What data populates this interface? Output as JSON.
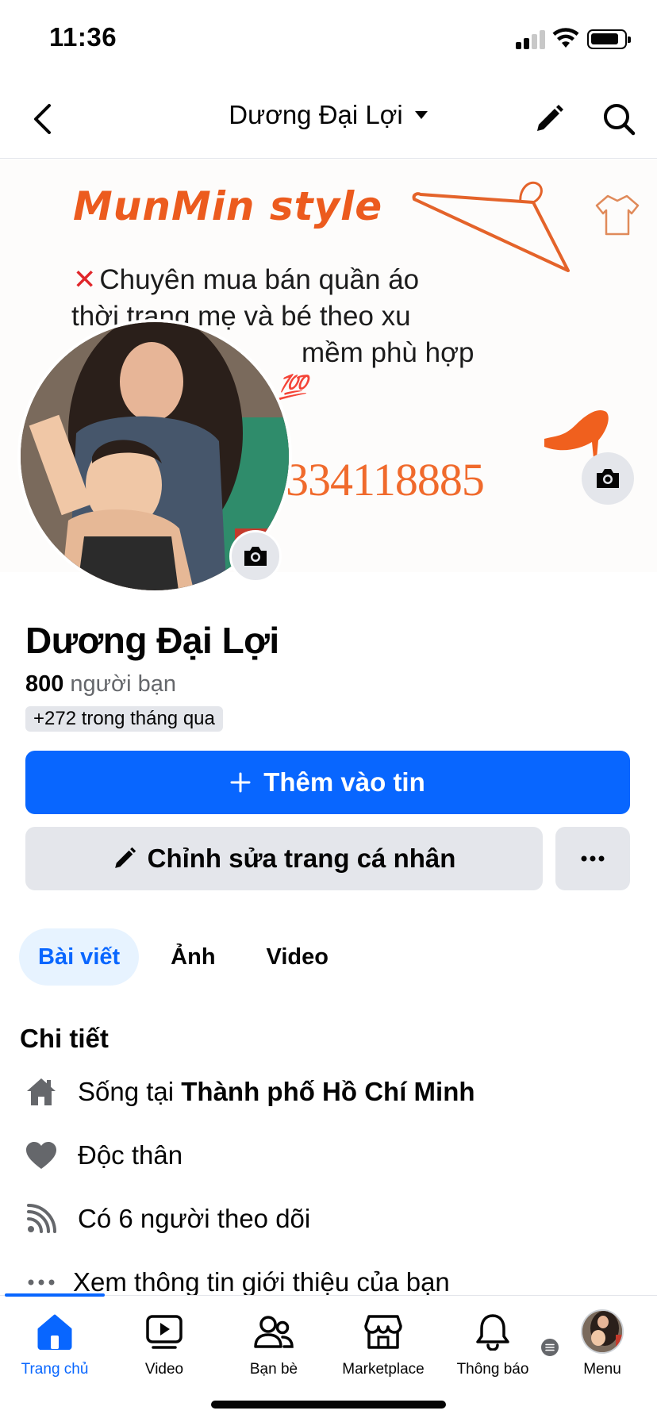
{
  "status_bar": {
    "time": "11:36"
  },
  "header": {
    "title": "Dương Đại Lợi"
  },
  "cover": {
    "brand": "MunMin style",
    "line1": "Chuyên mua bán quần áo",
    "line2": "thời trang mẹ và bé theo xu",
    "line3": "mềm phù hợp",
    "line4": "💯",
    "phone": "334118885"
  },
  "profile": {
    "name": "Dương Đại Lợi",
    "friends_count": "800",
    "friends_label": "người bạn",
    "friends_badge": "+272 trong tháng qua"
  },
  "actions": {
    "add_story": "Thêm vào tin",
    "edit_profile": "Chỉnh sửa trang cá nhân"
  },
  "tabs": [
    {
      "label": "Bài viết",
      "active": true
    },
    {
      "label": "Ảnh",
      "active": false
    },
    {
      "label": "Video",
      "active": false
    }
  ],
  "details": {
    "title": "Chi tiết",
    "lives_prefix": "Sống tại",
    "lives_city": "Thành phố Hồ Chí Minh",
    "relationship": "Độc thân",
    "followers": "Có 6 người theo dõi",
    "see_about": "Xem thông tin giới thiệu của bạn"
  },
  "bottom_nav": [
    {
      "label": "Trang chủ",
      "icon": "home-icon",
      "active": true
    },
    {
      "label": "Video",
      "icon": "video-icon",
      "active": false
    },
    {
      "label": "Bạn bè",
      "icon": "friends-icon",
      "active": false
    },
    {
      "label": "Marketplace",
      "icon": "marketplace-icon",
      "active": false
    },
    {
      "label": "Thông báo",
      "icon": "bell-icon",
      "active": false
    },
    {
      "label": "Menu",
      "icon": "menu-avatar",
      "active": false
    }
  ],
  "colors": {
    "accent": "#0866ff",
    "button_bg": "#e4e6eb",
    "active_tab_bg": "#e7f3ff",
    "secondary_text": "#65676b",
    "cover_orange": "#ec5b1e"
  }
}
